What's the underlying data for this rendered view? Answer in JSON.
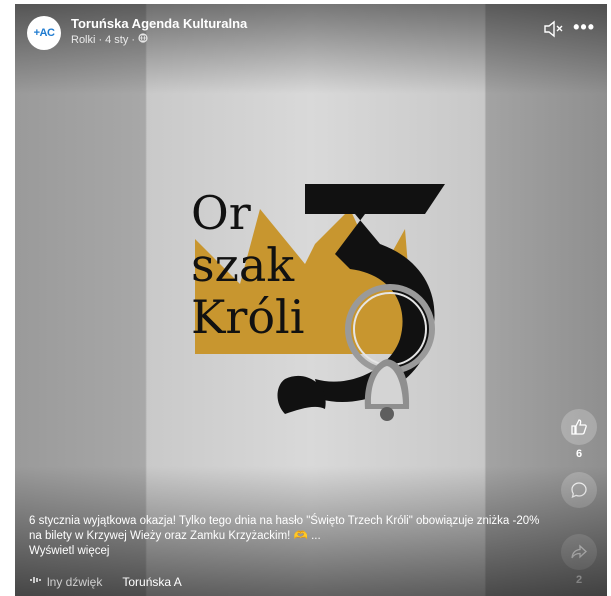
{
  "header": {
    "avatar_text": "+AC",
    "page_name": "Toruńska Agenda Kulturalna",
    "meta_type": "Rolki",
    "meta_date": "4 sty",
    "more_label": "•••"
  },
  "artwork": {
    "line1": "Or",
    "line2": "szak",
    "line3": "Króli",
    "number": "3",
    "colors": {
      "gold": "#c8962f",
      "black": "#111111",
      "bg": "#d9d9d9"
    }
  },
  "actions": {
    "like_count": "6",
    "share_count": "2"
  },
  "caption": {
    "text": "6 stycznia wyjątkowa okazja! Tylko tego dnia na hasło \"Święto Trzech Króli\" obowiązuje zniżka -20% na bilety w Krzywej Wieży oraz Zamku Krzyżackim! 🫶 ...",
    "see_more": "Wyświetl więcej"
  },
  "audio": {
    "sound_label": "lny dźwięk",
    "author": "Toruńska A"
  },
  "icons": [
    "globe-icon",
    "mute-icon",
    "more-icon",
    "like-icon",
    "comment-icon",
    "share-icon",
    "audio-wave-icon"
  ]
}
